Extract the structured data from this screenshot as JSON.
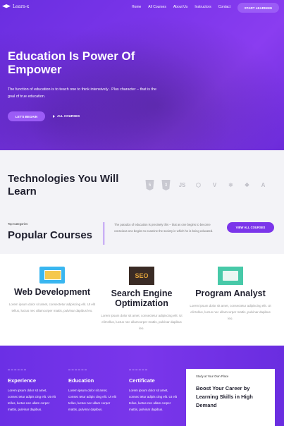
{
  "brand": {
    "name": "Learn-x"
  },
  "nav": {
    "links": [
      "Home",
      "All Courses",
      "About Us",
      "Instructors",
      "Contact"
    ],
    "cta": "START LEARNING"
  },
  "hero": {
    "title": "Education Is Power Of Empower",
    "description": "The function of education is to teach one to think intensively . Plus character – that is the goal of true education.",
    "primary_button": "LET'S BEGAIN",
    "secondary_button": "ALL COURSES"
  },
  "technologies": {
    "title": "Technologies You Will Learn",
    "icons": [
      "html5-icon",
      "css3-icon",
      "js-icon",
      "node-icon",
      "vue-icon",
      "react-icon",
      "python-icon",
      "angular-icon"
    ],
    "icon_glyphs": [
      "5",
      "3",
      "JS",
      "⬡",
      "V",
      "⚛",
      "❖",
      "A"
    ]
  },
  "categories": {
    "tag": "Top Categories",
    "title": "Popular Courses",
    "description": "The paradox of education is precisely this – that as one begins to become conscious one begins to examine the society in which he is being educated.",
    "button": "VIEW ALL COURSES"
  },
  "courses": [
    {
      "title": "Web Development",
      "text": "Lorem ipsum dolor sit amet, consectetur adipiscing elit. Ut elit tellus, luctus nec ullamcorper mattis, pulvinar dapibus leo."
    },
    {
      "title": "Search Engine Optimization",
      "text": "Lorem ipsum dolor sit amet, consectetur adipiscing elit. Ut elit tellus, luctus nec ullamcorper mattis, pulvinar dapibus leo."
    },
    {
      "title": "Program Analyst",
      "text": "Lorem ipsum dolor sit amet, consectetur adipiscing elit. Ut elit tellus, luctus nec ullamcorper mattis, pulvinar dapibus leo."
    }
  ],
  "features": [
    {
      "title": "Experience",
      "text": "Lorem ipsum dolor sit amet, consec tetur adipis cing elit. Ut elit tellus, luctus nec ullam corper mattis, pulvinar dapibus."
    },
    {
      "title": "Education",
      "text": "Lorem ipsum dolor sit amet, consec tetur adipis cing elit. Ut elit tellus, luctus nec ullam corper mattis, pulvinar dapibus."
    },
    {
      "title": "Certificate",
      "text": "Lorem ipsum dolor sit amet, consec tetur adipis cing elit. Ut elit tellus, luctus nec ullam corper mattis, pulvinar dapibus."
    }
  ],
  "promo": {
    "tag": "Study at Your Own Place",
    "title": "Boost Your Career by Learning Skills in High Demand"
  },
  "colors": {
    "primary": "#7b35ea",
    "accent": "#9b5cf6",
    "background": "#f3f3f7"
  }
}
